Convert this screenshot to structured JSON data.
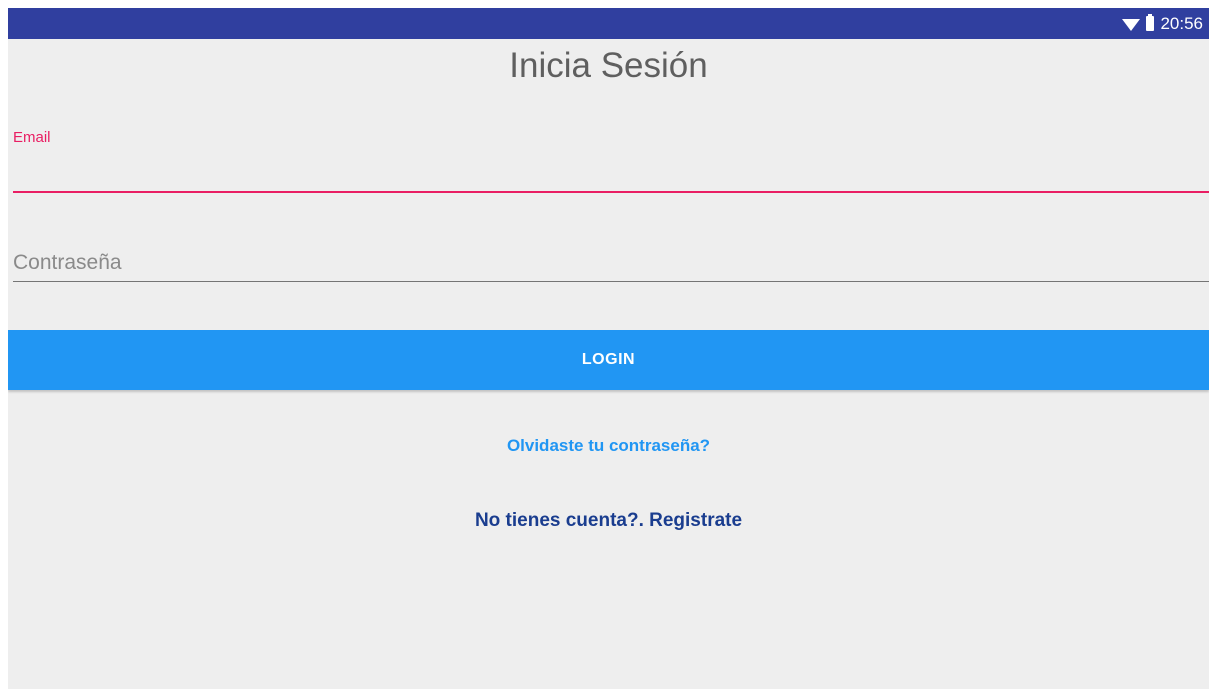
{
  "status_bar": {
    "time": "20:56",
    "icons": [
      "wifi-icon",
      "battery-icon"
    ],
    "color": "#303f9f"
  },
  "page": {
    "title": "Inicia Sesión"
  },
  "form": {
    "email": {
      "label": "Email",
      "value": "",
      "accent_color": "#e91e63"
    },
    "password": {
      "placeholder": "Contraseña",
      "value": ""
    },
    "login_button": {
      "label": "LOGIN",
      "color": "#2196f3"
    }
  },
  "links": {
    "forgot_password": "Olvidaste tu contraseña?",
    "register": "No tienes cuenta?. Registrate"
  }
}
